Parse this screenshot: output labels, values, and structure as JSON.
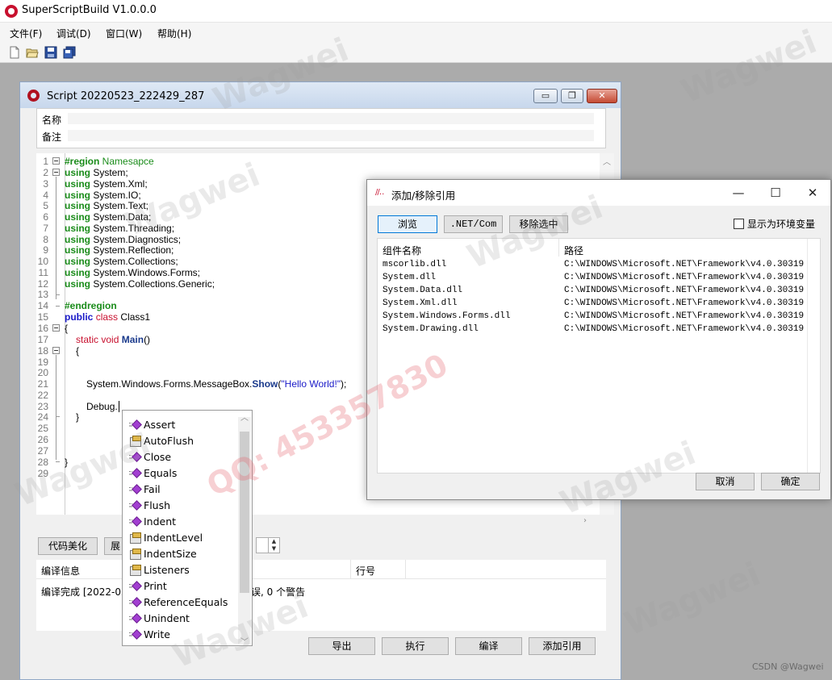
{
  "app": {
    "title": "SuperScriptBuild V1.0.0.0"
  },
  "menu": [
    "文件(F)",
    "调试(D)",
    "窗口(W)",
    "帮助(H)"
  ],
  "toolbar_icons": [
    "new-file-icon",
    "open-folder-icon",
    "save-icon",
    "save-all-icon"
  ],
  "script_window": {
    "title": "Script 20220523_222429_287",
    "controls": {
      "minimize": "▭",
      "restore": "❐",
      "close": "✕"
    },
    "props": {
      "name_label": "名称",
      "note_label": "备注"
    }
  },
  "editor": {
    "line_numbers": [
      "1",
      "2",
      "3",
      "4",
      "5",
      "6",
      "7",
      "8",
      "9",
      "10",
      "11",
      "12",
      "13",
      "14",
      "15",
      "16",
      "17",
      "18",
      "19",
      "20",
      "21",
      "22",
      "23",
      "24",
      "25",
      "26",
      "27",
      "28",
      "29"
    ],
    "lines": {
      "l1": {
        "kw": "#region",
        "text": " Namesapce"
      },
      "l2": {
        "kw": "using",
        "text": " System;"
      },
      "l3": {
        "kw": "using",
        "text": " System.Xml;"
      },
      "l4": {
        "kw": "using",
        "text": " System.IO;"
      },
      "l5": {
        "kw": "using",
        "text": " System.Text;"
      },
      "l6": {
        "kw": "using",
        "text": " System.Data;"
      },
      "l7": {
        "kw": "using",
        "text": " System.Threading;"
      },
      "l8": {
        "kw": "using",
        "text": " System.Diagnostics;"
      },
      "l9": {
        "kw": "using",
        "text": " System.Reflection;"
      },
      "l10": {
        "kw": "using",
        "text": " System.Collections;"
      },
      "l11": {
        "kw": "using",
        "text": " System.Windows.Forms;"
      },
      "l12": {
        "kw": "using",
        "text": " System.Collections.Generic;"
      },
      "l14": {
        "kw": "#endregion"
      },
      "l15": {
        "kw1": "public",
        "kw2": "class",
        "text": " Class1"
      },
      "l16": {
        "text": "{"
      },
      "l17": {
        "kw1": "static",
        "kw2": "void",
        "name": "Main",
        "text": "()"
      },
      "l18": {
        "text": "{"
      },
      "l21": {
        "prefix": "System.Windows.Forms.MessageBox.",
        "method": "Show",
        "open": "(",
        "str": "\"Hello World!\"",
        "close": ");"
      },
      "l23": {
        "text": "Debug."
      },
      "l24": {
        "text": "}"
      },
      "l29": {
        "text": "}"
      }
    }
  },
  "buttons": {
    "beautify": "代码美化",
    "expand": "展",
    "export": "导出",
    "run": "执行",
    "compile": "编译",
    "add_reference": "添加引用"
  },
  "build_info": {
    "col_info": "编译信息",
    "col_line": "行号",
    "message_left": "编译完成 [2022-05",
    "message_right": "错误, 0 个警告"
  },
  "autocomplete": {
    "items": [
      {
        "label": "Assert",
        "icon": "method-icon"
      },
      {
        "label": "AutoFlush",
        "icon": "property-icon"
      },
      {
        "label": "Close",
        "icon": "method-icon"
      },
      {
        "label": "Equals",
        "icon": "method-icon"
      },
      {
        "label": "Fail",
        "icon": "method-icon"
      },
      {
        "label": "Flush",
        "icon": "method-icon"
      },
      {
        "label": "Indent",
        "icon": "method-icon"
      },
      {
        "label": "IndentLevel",
        "icon": "property-icon"
      },
      {
        "label": "IndentSize",
        "icon": "property-icon"
      },
      {
        "label": "Listeners",
        "icon": "property-icon"
      },
      {
        "label": "Print",
        "icon": "method-icon"
      },
      {
        "label": "ReferenceEquals",
        "icon": "method-icon"
      },
      {
        "label": "Unindent",
        "icon": "method-icon"
      },
      {
        "label": "Write",
        "icon": "method-icon"
      }
    ]
  },
  "ref_dialog": {
    "title": "添加/移除引用",
    "controls": {
      "minimize": "—",
      "maximize": "☐",
      "close": "✕"
    },
    "buttons": {
      "browse": "浏览",
      "netcom": ".NET/Com",
      "remove": "移除选中",
      "cancel": "取消",
      "ok": "确定"
    },
    "env_checkbox_label": "显示为环境变量",
    "columns": {
      "name": "组件名称",
      "path": "路径"
    },
    "rows": [
      {
        "name": "mscorlib.dll",
        "path": "C:\\WINDOWS\\Microsoft.NET\\Framework\\v4.0.30319"
      },
      {
        "name": "System.dll",
        "path": "C:\\WINDOWS\\Microsoft.NET\\Framework\\v4.0.30319"
      },
      {
        "name": "System.Data.dll",
        "path": "C:\\WINDOWS\\Microsoft.NET\\Framework\\v4.0.30319"
      },
      {
        "name": "System.Xml.dll",
        "path": "C:\\WINDOWS\\Microsoft.NET\\Framework\\v4.0.30319"
      },
      {
        "name": "System.Windows.Forms.dll",
        "path": "C:\\WINDOWS\\Microsoft.NET\\Framework\\v4.0.30319"
      },
      {
        "name": "System.Drawing.dll",
        "path": "C:\\WINDOWS\\Microsoft.NET\\Framework\\v4.0.30319"
      }
    ]
  },
  "watermarks": {
    "brand": "Wagwei",
    "qq": "QQ: 453357830",
    "credit": "CSDN @Wagwei"
  },
  "colors": {
    "keyword_green": "#1a8c1a",
    "keyword_blue": "#1a1ac8",
    "keyword_red": "#c8102e",
    "dialog_accent": "#0078d7"
  }
}
